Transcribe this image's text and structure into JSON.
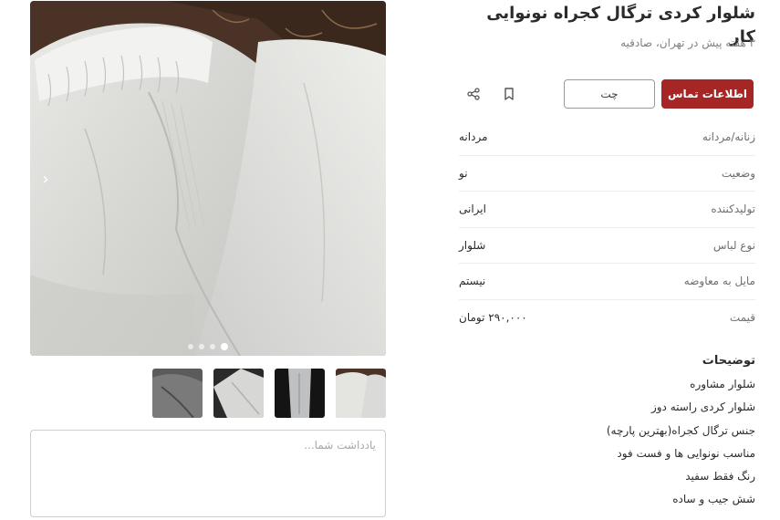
{
  "listing": {
    "title": "شلوار کردی ترگال کجراه نونوایی کار",
    "subtitle": "۳ هفته پیش در تهران، صادقیه"
  },
  "actions": {
    "contact_label": "اطلاعات تماس",
    "chat_label": "چت",
    "bookmark_icon": "bookmark-icon",
    "share_icon": "share-icon"
  },
  "attributes": [
    {
      "key": "زنانه/مردانه",
      "value": "مردانه"
    },
    {
      "key": "وضعیت",
      "value": "نو"
    },
    {
      "key": "تولیدکننده",
      "value": "ایرانی"
    },
    {
      "key": "نوع لباس",
      "value": "شلوار"
    },
    {
      "key": "مایل به معاوضه",
      "value": "نیستم"
    },
    {
      "key": "قیمت",
      "value": "۲۹۰,۰۰۰ تومان"
    }
  ],
  "description": {
    "heading": "توضیحات",
    "lines": [
      "شلوار مشاوره",
      "شلوار کردی راسته دوز",
      "جنس ترگال کجراه(بهترین پارچه)",
      "مناسب نونوایی ها و فست فود",
      "رنگ فقط سفید",
      "شش جیب و ساده"
    ]
  },
  "gallery": {
    "image_count": 4,
    "active_index": 3,
    "thumbnail_count": 4
  },
  "note": {
    "placeholder": "یادداشت شما...",
    "value": ""
  },
  "colors": {
    "accent": "#a62626",
    "text": "#2b2b2b",
    "muted": "#808080",
    "divider": "#ececec"
  }
}
